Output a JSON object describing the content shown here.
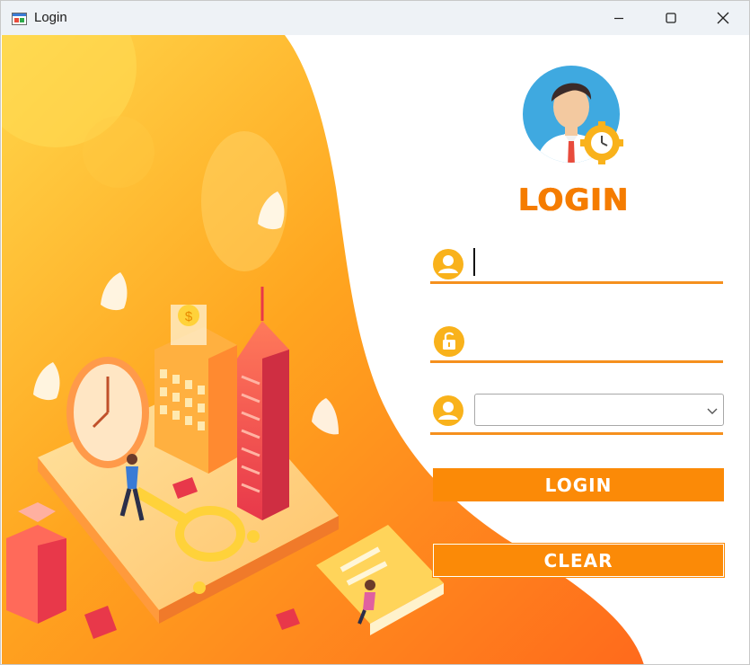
{
  "window": {
    "title": "Login",
    "controls": [
      "minimize",
      "maximize",
      "close"
    ]
  },
  "colors": {
    "accent": "#f57c00",
    "button": "#fb8a07",
    "underline": "#f5901e",
    "icon_circle": "#f9b21b",
    "illustration_gradient": [
      "#ffd64a",
      "#ffa51f",
      "#ff6a1c"
    ]
  },
  "form": {
    "heading": "LOGIN",
    "username": {
      "icon": "user-icon",
      "value": "",
      "placeholder": ""
    },
    "password": {
      "icon": "unlock-icon",
      "value": "",
      "placeholder": ""
    },
    "role": {
      "icon": "user-icon",
      "selected": ""
    },
    "login_button": "LOGIN",
    "clear_button": "CLEAR"
  }
}
